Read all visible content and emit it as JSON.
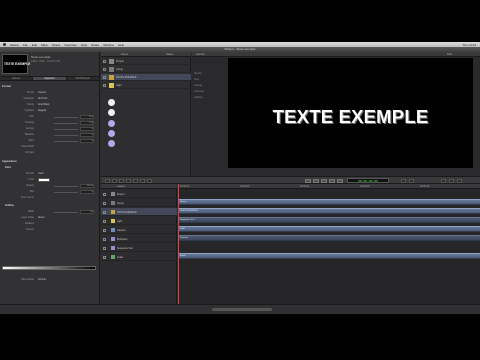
{
  "app": {
    "window_title": "Motion - Texte exemple",
    "menu": [
      "Motion",
      "File",
      "Edit",
      "Mark",
      "Object",
      "Favorites",
      "View",
      "Share",
      "Window",
      "Help"
    ],
    "clock": "Thu 14:32"
  },
  "project": {
    "thumb_text": "TEXTE EXEMPLE",
    "name": "Texte exemple",
    "info": "1920 x 1080 · 00:00:10:00"
  },
  "inspector": {
    "tabs": [
      "Library",
      "Inspector",
      "File Browser"
    ],
    "sections": {
      "format": "Format",
      "appearance": "Appearance",
      "face": "Face",
      "outline": "Outline"
    },
    "rows": [
      {
        "label": "Preset",
        "value": "Custom"
      },
      {
        "label": "Collection",
        "value": "All Fonts"
      },
      {
        "label": "Family",
        "value": "Arial Black"
      },
      {
        "label": "Typeface",
        "value": "Regular"
      },
      {
        "label": "Size",
        "value": "72.0"
      },
      {
        "label": "Tracking",
        "value": "0 %"
      },
      {
        "label": "Kerning",
        "value": "0"
      },
      {
        "label": "Baseline",
        "value": "0"
      },
      {
        "label": "Slant",
        "value": "0"
      },
      {
        "label": "Fixed Width",
        "value": ""
      },
      {
        "label": "All Caps",
        "value": ""
      },
      {
        "label": "Fill with",
        "value": "Color"
      },
      {
        "label": "Color",
        "value": ""
      },
      {
        "label": "Opacity",
        "value": "100 %"
      },
      {
        "label": "Blur",
        "value": "0"
      },
      {
        "label": "Four Corner",
        "value": ""
      },
      {
        "label": "Width",
        "value": "2.0"
      },
      {
        "label": "Layer Order",
        "value": "Above"
      },
      {
        "label": "Gradient",
        "value": ""
      },
      {
        "label": "Texture",
        "value": ""
      },
      {
        "label": "Blend Mode",
        "value": "Normal"
      },
      {
        "label": "Outline",
        "value": ""
      }
    ]
  },
  "layers": {
    "header": [
      "Name",
      "Status"
    ],
    "items": [
      {
        "name": "Project"
      },
      {
        "name": "Group"
      },
      {
        "name": "TEXTE EXEMPLE"
      },
      {
        "name": "Light"
      }
    ]
  },
  "viewer": {
    "header": "Canvas",
    "zoom": "50%",
    "title_text": "TEXTE EXEMPLE",
    "side": [
      "Render",
      "View",
      "Overlay",
      "Channels",
      "Lighting"
    ]
  },
  "transport": {
    "timecode": "00:00:00;00"
  },
  "timeline": {
    "header": "Layers",
    "rows": [
      {
        "name": "Project"
      },
      {
        "name": "Group"
      },
      {
        "name": "TEXTE EXEMPLE"
      },
      {
        "name": "Light"
      },
      {
        "name": "Camera"
      },
      {
        "name": "Behaviors"
      },
      {
        "name": "Sequence Text"
      },
      {
        "name": "Audio"
      }
    ],
    "ruler": [
      "00:00:00",
      "00:00:02",
      "00:00:04",
      "00:00:06",
      "00:00:08"
    ],
    "tracks": [
      "Group",
      "TEXTE EXEMPLE",
      "Sequence Text",
      "Light",
      "Camera",
      "Audio"
    ]
  },
  "colors": {
    "accent": "#43475a",
    "track": "#5b6b88",
    "timecode": "#5ee05e"
  }
}
